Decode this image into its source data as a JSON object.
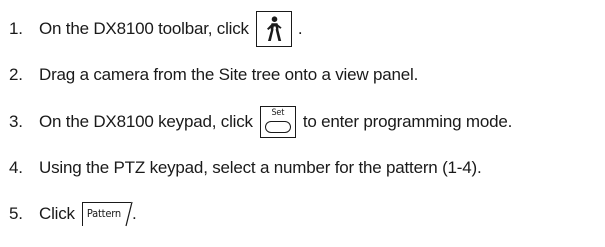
{
  "steps": [
    {
      "number": "1.",
      "text_before": "On the DX8100 toolbar, click",
      "icon": "walking-person-icon",
      "text_after": "."
    },
    {
      "number": "2.",
      "text": "Drag a camera from the Site tree onto a view panel."
    },
    {
      "number": "3.",
      "text_before": "On the DX8100 keypad, click",
      "key_label": "Set",
      "text_after": "to enter programming mode."
    },
    {
      "number": "4.",
      "text": "Using the PTZ keypad, select a number for the pattern (1-4)."
    },
    {
      "number": "5.",
      "text_before": "Click",
      "button_label": "Pattern",
      "text_after": "."
    }
  ],
  "colors": {
    "text": "#1a1a1a",
    "background": "#ffffff"
  }
}
